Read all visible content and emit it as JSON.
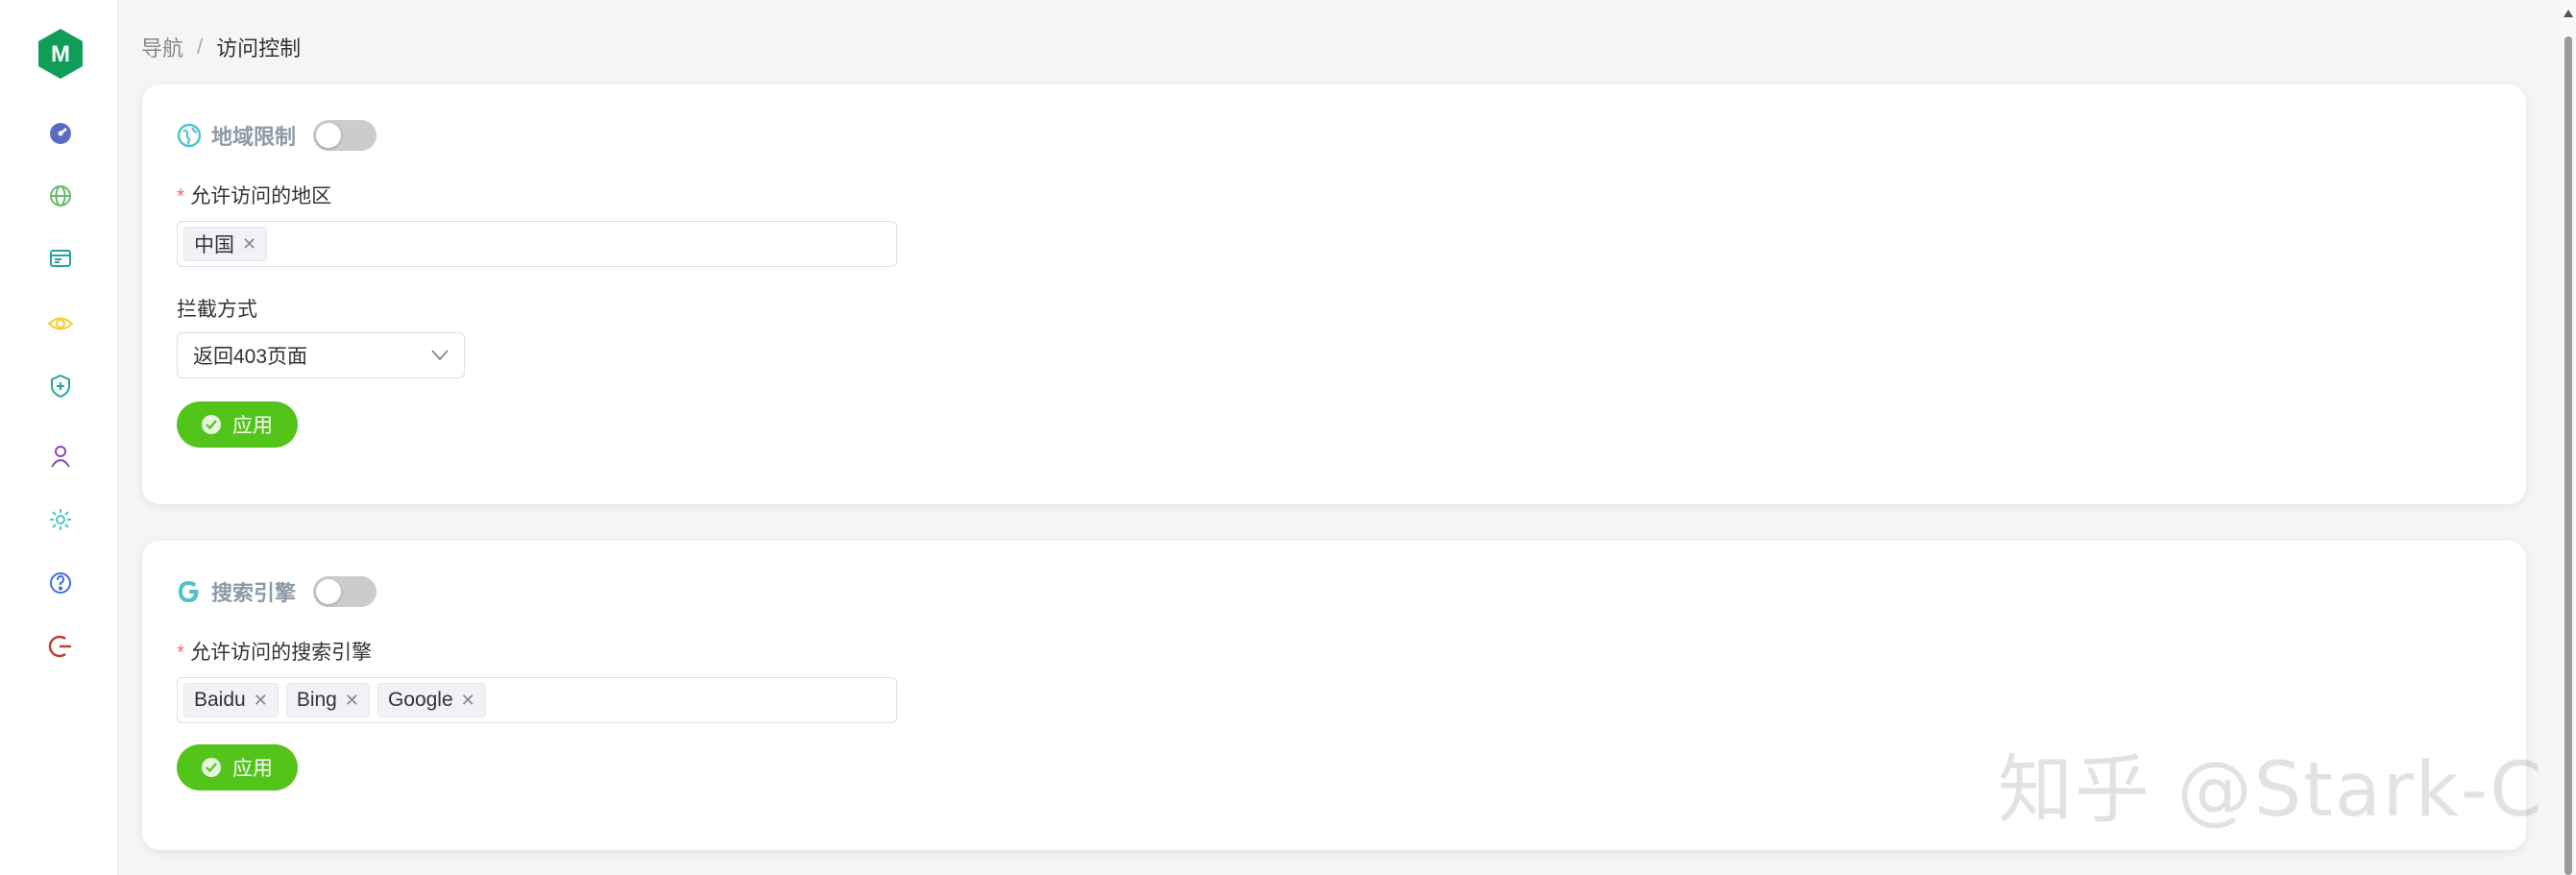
{
  "breadcrumb": {
    "root": "导航",
    "separator": "/",
    "current": "访问控制"
  },
  "sidebar": {
    "logo_letter": "M",
    "items": [
      {
        "icon": "dashboard-icon",
        "color": "#5c6bc0"
      },
      {
        "icon": "globe-icon",
        "color": "#66bb6a"
      },
      {
        "icon": "website-icon",
        "color": "#26a69a"
      },
      {
        "icon": "eye-icon",
        "color": "#f4d03f"
      },
      {
        "icon": "shield-icon",
        "color": "#26a69a"
      },
      {
        "icon": "user-icon",
        "color": "#8e44ad"
      },
      {
        "icon": "gear-icon",
        "color": "#4fc3c7"
      },
      {
        "icon": "help-icon",
        "color": "#3f6fd8"
      },
      {
        "icon": "logout-icon",
        "color": "#c0392b"
      }
    ]
  },
  "geo": {
    "title": "地域限制",
    "allowed_label": "允许访问的地区",
    "tags": [
      "中国"
    ],
    "block_label": "拦截方式",
    "block_value": "返回403页面",
    "apply_label": "应用"
  },
  "search": {
    "title": "搜索引擎",
    "allowed_label": "允许访问的搜索引擎",
    "tags": [
      "Baidu",
      "Bing",
      "Google"
    ],
    "apply_label": "应用"
  },
  "watermark": "知乎 @Stark-C",
  "colors": {
    "accent": "#52c41a",
    "brand": "#0f9d58",
    "required": "#f56c6c"
  }
}
